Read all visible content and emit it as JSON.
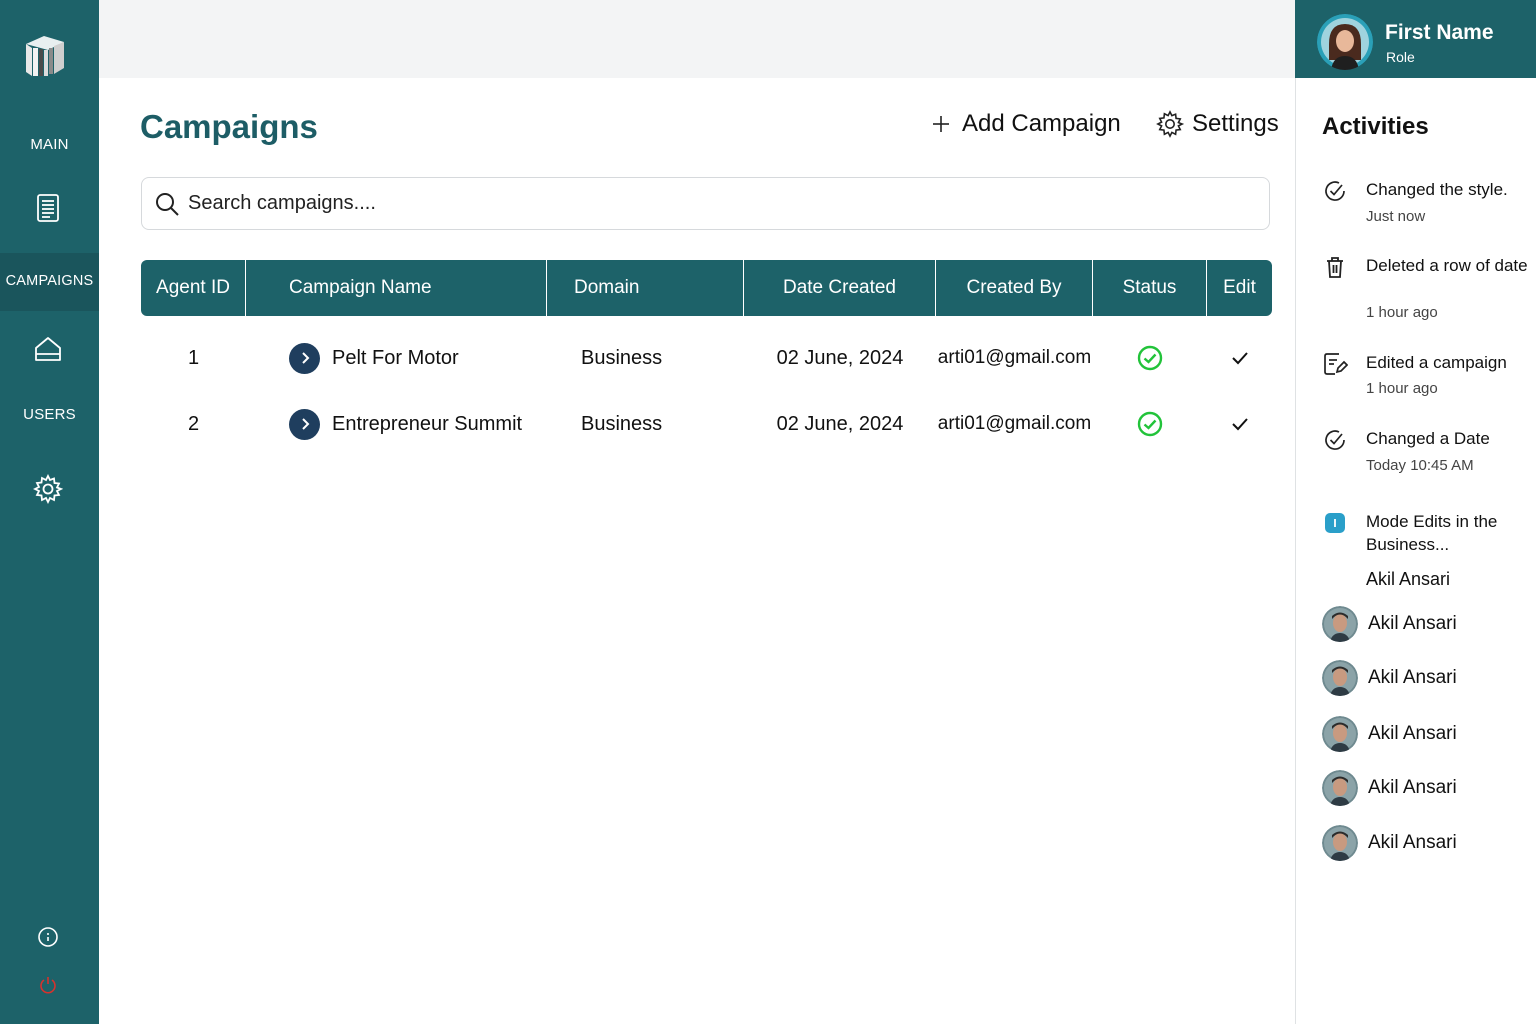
{
  "sidebar": {
    "items": [
      {
        "label": "MAIN"
      },
      {
        "label": "CAMPAIGNS",
        "active": true
      },
      {
        "label": "USERS"
      }
    ],
    "icons": [
      "books-logo-icon",
      "document-icon",
      "home-icon",
      "gear-icon",
      "info-icon",
      "power-icon"
    ]
  },
  "main": {
    "title": "Campaigns",
    "add_label": "Add Campaign",
    "settings_label": "Settings",
    "search": {
      "placeholder": "Search campaigns...."
    },
    "table": {
      "headers": [
        "Agent ID",
        "Campaign Name",
        "Domain",
        "Date Created",
        "Created By",
        "Status",
        "Edit"
      ],
      "rows": [
        {
          "id": "1",
          "name": "Pelt For Motor",
          "domain": "Business",
          "date": "02 June, 2024",
          "created_by": "arti01@gmail.com",
          "status": "active"
        },
        {
          "id": "2",
          "name": "Entrepreneur Summit",
          "domain": "Business",
          "date": "02 June, 2024",
          "created_by": "arti01@gmail.com",
          "status": "active"
        }
      ]
    }
  },
  "profile": {
    "name": "First Name",
    "role": "Role"
  },
  "activities": {
    "title": "Activities",
    "items": [
      {
        "title": "Changed the style.",
        "time": "Just now",
        "icon": "clock-check-icon"
      },
      {
        "title": "Deleted a row of date",
        "time": "1 hour ago",
        "icon": "trash-icon"
      },
      {
        "title": "Edited a campaign",
        "time": "1 hour ago",
        "icon": "edit-doc-icon"
      },
      {
        "title": "Changed a Date",
        "time": "Today 10:45 AM",
        "icon": "clock-check-icon"
      },
      {
        "title": "Mode Edits in the Business...",
        "time": "",
        "icon": "info-badge-icon"
      }
    ],
    "last_actor": "Akil Ansari",
    "users": [
      {
        "name": "Akil Ansari"
      },
      {
        "name": "Akil Ansari"
      },
      {
        "name": "Akil Ansari"
      },
      {
        "name": "Akil Ansari"
      },
      {
        "name": "Akil Ansari"
      }
    ]
  },
  "colors": {
    "teal": "#1d6269",
    "title": "#1d5d66",
    "chevron": "#1f3e5e",
    "status_green": "#22c33a",
    "info_blue": "#2a9fc9"
  }
}
